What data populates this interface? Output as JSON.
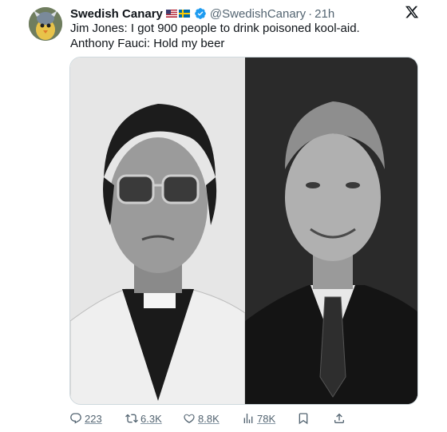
{
  "tweet": {
    "display_name": "Swedish Canary",
    "handle": "@SwedishCanary",
    "separator": "·",
    "time": "21h",
    "flags": [
      "us-flag",
      "sweden-flag"
    ],
    "verified": true,
    "lines": [
      "Jim Jones: I got 900 people to drink poisoned kool-aid.",
      "Anthony Fauci: Hold my beer"
    ],
    "media": {
      "left_image": "black-and-white photo of Jim Jones in sunglasses and clerical collar",
      "right_image": "black-and-white portrait of Anthony Fauci smiling in suit and tie"
    },
    "actions": {
      "replies": "223",
      "reposts": "6.3K",
      "likes": "8.8K",
      "views": "78K"
    }
  },
  "colors": {
    "text": "#0f1419",
    "secondary": "#536471",
    "verified": "#1d9bf0"
  },
  "icons": {
    "close": "x-logo-icon",
    "reply": "reply-icon",
    "repost": "repost-icon",
    "like": "heart-icon",
    "views": "views-icon",
    "bookmark": "bookmark-icon",
    "share": "share-icon"
  }
}
